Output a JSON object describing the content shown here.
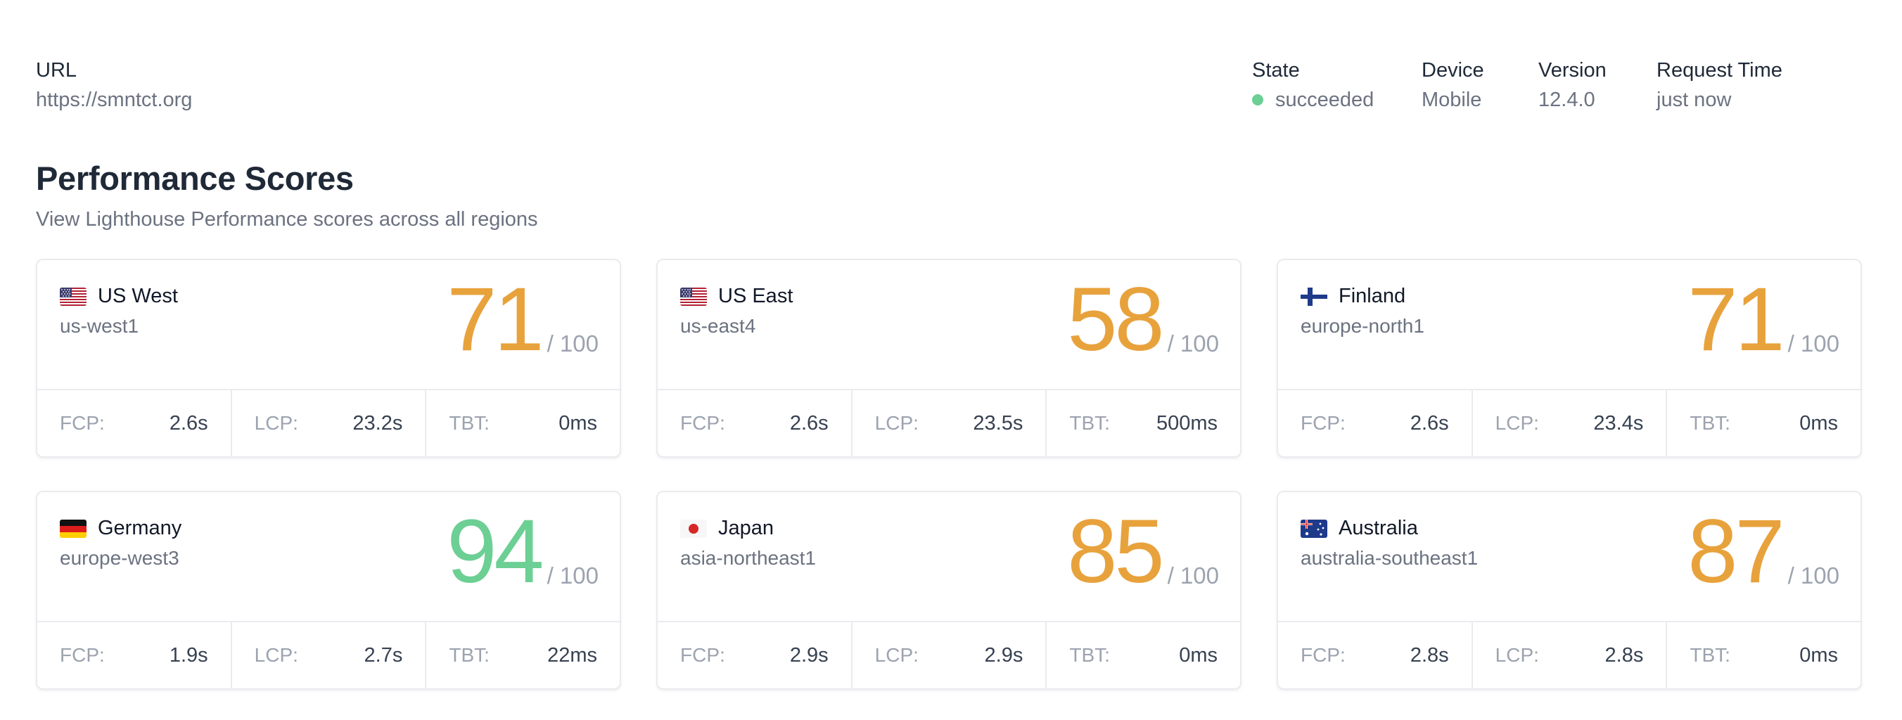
{
  "meta": {
    "url_label": "URL",
    "url_value": "https://smntct.org",
    "state_label": "State",
    "state_value": "succeeded",
    "device_label": "Device",
    "device_value": "Mobile",
    "version_label": "Version",
    "version_value": "12.4.0",
    "request_label": "Request Time",
    "request_value": "just now"
  },
  "section": {
    "title": "Performance Scores",
    "subtitle": "View Lighthouse Performance scores across all regions"
  },
  "out_of": "/ 100",
  "metric_labels": {
    "fcp": "FCP:",
    "lcp": "LCP:",
    "tbt": "TBT:"
  },
  "colors": {
    "orange": "#e8a23c",
    "green": "#6ccf94"
  },
  "regions": [
    {
      "name": "US West",
      "zone": "us-west1",
      "score": "71",
      "flag": "us-flag-icon",
      "fcp": "2.6s",
      "lcp": "23.2s",
      "tbt": "0ms"
    },
    {
      "name": "US East",
      "zone": "us-east4",
      "score": "58",
      "flag": "us-flag-icon",
      "fcp": "2.6s",
      "lcp": "23.5s",
      "tbt": "500ms"
    },
    {
      "name": "Finland",
      "zone": "europe-north1",
      "score": "71",
      "flag": "finland-flag-icon",
      "fcp": "2.6s",
      "lcp": "23.4s",
      "tbt": "0ms"
    },
    {
      "name": "Germany",
      "zone": "europe-west3",
      "score": "94",
      "flag": "germany-flag-icon",
      "fcp": "1.9s",
      "lcp": "2.7s",
      "tbt": "22ms"
    },
    {
      "name": "Japan",
      "zone": "asia-northeast1",
      "score": "85",
      "flag": "japan-flag-icon",
      "fcp": "2.9s",
      "lcp": "2.9s",
      "tbt": "0ms"
    },
    {
      "name": "Australia",
      "zone": "australia-southeast1",
      "score": "87",
      "flag": "australia-flag-icon",
      "fcp": "2.8s",
      "lcp": "2.8s",
      "tbt": "0ms"
    }
  ]
}
